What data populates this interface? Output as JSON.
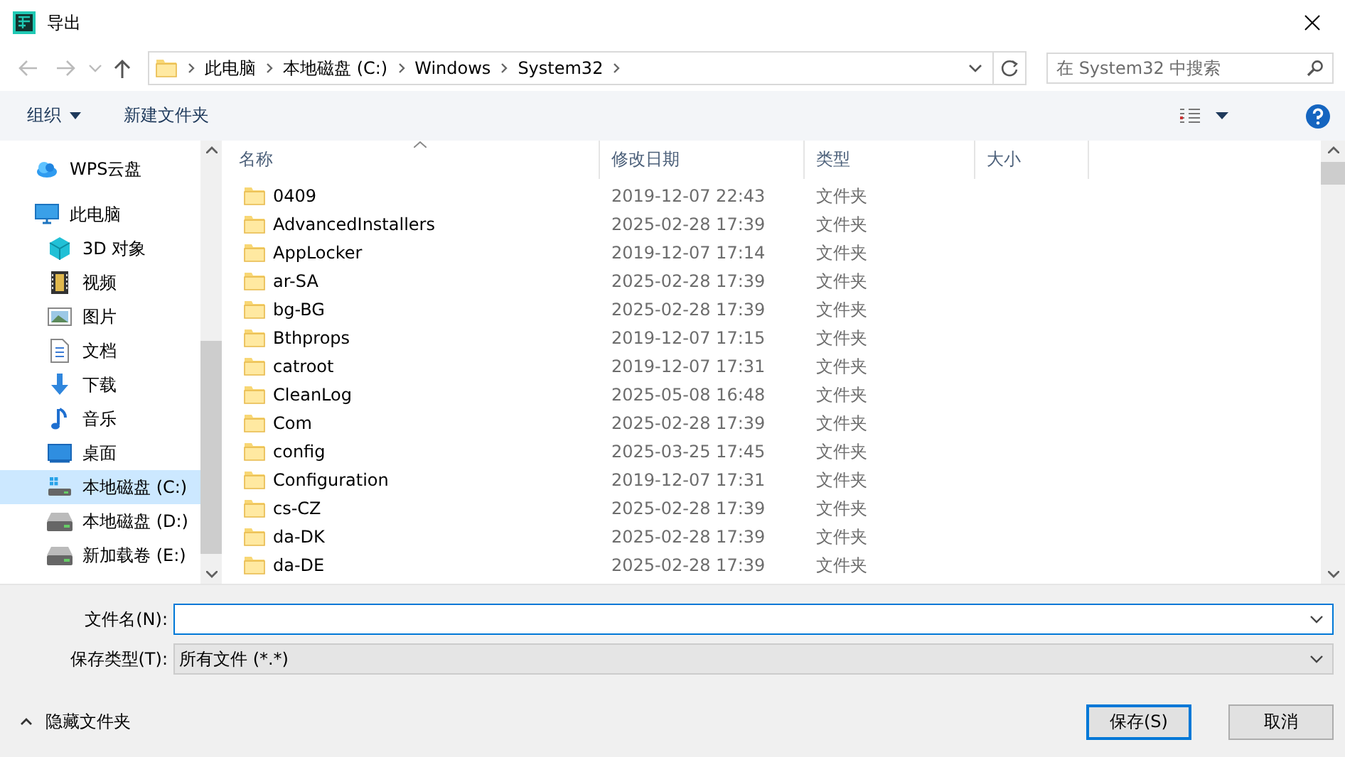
{
  "window": {
    "title": "导出"
  },
  "address": {
    "crumbs": [
      "此电脑",
      "本地磁盘 (C:)",
      "Windows",
      "System32"
    ]
  },
  "search": {
    "placeholder": "在 System32 中搜索"
  },
  "toolbar": {
    "organize": "组织",
    "new_folder": "新建文件夹"
  },
  "sidebar": {
    "items": [
      {
        "label": "WPS云盘",
        "kind": "cloud",
        "selected": false
      },
      {
        "label": "此电脑",
        "kind": "pc",
        "selected": false,
        "children": [
          {
            "label": "3D 对象",
            "kind": "cube",
            "selected": false
          },
          {
            "label": "视频",
            "kind": "video",
            "selected": false
          },
          {
            "label": "图片",
            "kind": "picture",
            "selected": false
          },
          {
            "label": "文档",
            "kind": "document",
            "selected": false
          },
          {
            "label": "下载",
            "kind": "download",
            "selected": false
          },
          {
            "label": "音乐",
            "kind": "music",
            "selected": false
          },
          {
            "label": "桌面",
            "kind": "desktop",
            "selected": false
          },
          {
            "label": "本地磁盘 (C:)",
            "kind": "system-drive",
            "selected": true
          },
          {
            "label": "本地磁盘 (D:)",
            "kind": "drive",
            "selected": false
          },
          {
            "label": "新加载卷 (E:)",
            "kind": "drive",
            "selected": false
          }
        ]
      }
    ]
  },
  "table": {
    "columns": [
      {
        "label": "名称",
        "sorted": true
      },
      {
        "label": "修改日期",
        "sorted": false
      },
      {
        "label": "类型",
        "sorted": false
      },
      {
        "label": "大小",
        "sorted": false
      }
    ],
    "rows": [
      {
        "name": "0409",
        "modified": "2019-12-07 22:43",
        "type": "文件夹"
      },
      {
        "name": "AdvancedInstallers",
        "modified": "2025-02-28 17:39",
        "type": "文件夹"
      },
      {
        "name": "AppLocker",
        "modified": "2019-12-07 17:14",
        "type": "文件夹"
      },
      {
        "name": "ar-SA",
        "modified": "2025-02-28 17:39",
        "type": "文件夹"
      },
      {
        "name": "bg-BG",
        "modified": "2025-02-28 17:39",
        "type": "文件夹"
      },
      {
        "name": "Bthprops",
        "modified": "2019-12-07 17:15",
        "type": "文件夹"
      },
      {
        "name": "catroot",
        "modified": "2019-12-07 17:31",
        "type": "文件夹"
      },
      {
        "name": "CleanLog",
        "modified": "2025-05-08 16:48",
        "type": "文件夹"
      },
      {
        "name": "Com",
        "modified": "2025-02-28 17:39",
        "type": "文件夹"
      },
      {
        "name": "config",
        "modified": "2025-03-25 17:45",
        "type": "文件夹"
      },
      {
        "name": "Configuration",
        "modified": "2019-12-07 17:31",
        "type": "文件夹"
      },
      {
        "name": "cs-CZ",
        "modified": "2025-02-28 17:39",
        "type": "文件夹"
      },
      {
        "name": "da-DK",
        "modified": "2025-02-28 17:39",
        "type": "文件夹"
      },
      {
        "name": "da-DE",
        "modified": "2025-02-28 17:39",
        "type": "文件夹"
      }
    ]
  },
  "file_name": {
    "label": "文件名(N):",
    "focused": true
  },
  "save_type": {
    "label": "保存类型(T):",
    "value": "所有文件 (*.*)"
  },
  "hide_folders": "隐藏文件夹",
  "buttons": [
    {
      "label": "保存(S)",
      "default": true
    },
    {
      "label": "取消",
      "default": false
    }
  ]
}
